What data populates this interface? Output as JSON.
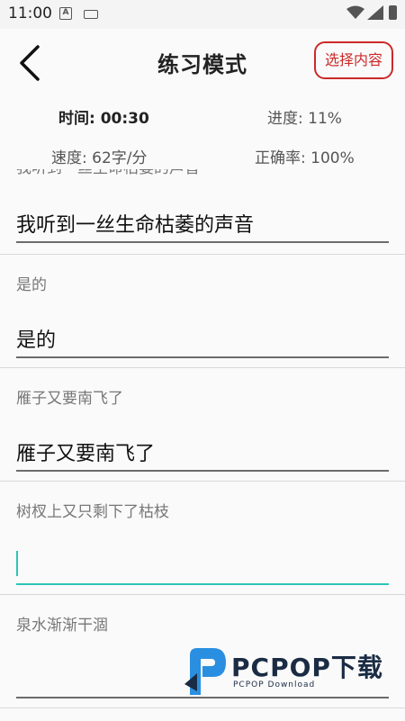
{
  "status_bar": {
    "time": "11:00",
    "a_icon": "A"
  },
  "header": {
    "title": "练习模式",
    "select_button": "选择内容"
  },
  "stats": {
    "time_label": "时间: 00:30",
    "progress_label": "进度: 11%",
    "speed_label": "速度: 62字/分",
    "accuracy_label": "正确率: 100%"
  },
  "rows": [
    {
      "prompt": "我听到一丝生命枯萎的声音",
      "answer": "我听到一丝生命枯萎的声音"
    },
    {
      "prompt": "是的",
      "answer": "是的"
    },
    {
      "prompt": "雁子又要南飞了",
      "answer": "雁子又要南飞了"
    },
    {
      "prompt": "树杈上又只剩下了枯枝",
      "answer": ""
    },
    {
      "prompt": "泉水渐渐干涸",
      "answer": ""
    }
  ],
  "watermark": {
    "text": "PCPOP下载",
    "sub": "PCPOP Download"
  },
  "colors": {
    "accent_red": "#cc2a2a",
    "active_cyan": "#2bc4b8",
    "watermark_blue": "#2a8fe0"
  }
}
